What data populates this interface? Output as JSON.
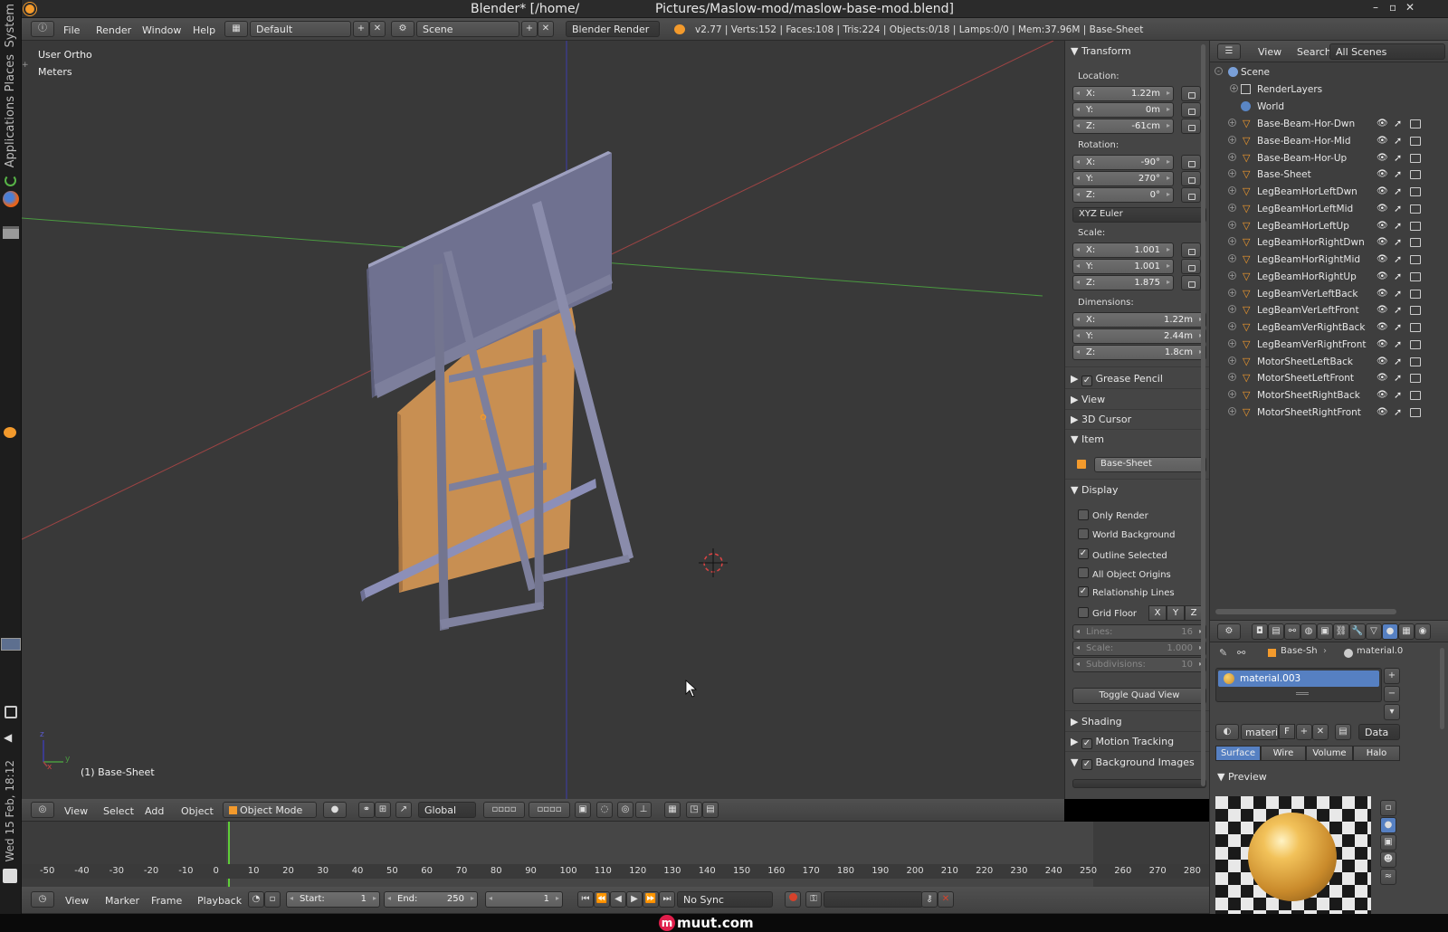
{
  "window": {
    "title_left": "Blender* [/home/",
    "title_right": "Pictures/Maslow-mod/maslow-base-mod.blend]",
    "controls": [
      "–",
      "▫",
      "✕"
    ]
  },
  "os_sidebar": {
    "labels": [
      "System",
      "Places",
      "Applications"
    ],
    "clock": "Wed 15 Feb, 18:12"
  },
  "info_header": {
    "menus": [
      "File",
      "Render",
      "Window",
      "Help"
    ],
    "layout": "Default",
    "scene": "Scene",
    "engine": "Blender Render",
    "stats": "v2.77 | Verts:152 | Faces:108 | Tris:224 | Objects:0/18 | Lamps:0/0 | Mem:37.96M | Base-Sheet"
  },
  "viewport": {
    "view_name": "User Ortho",
    "units": "Meters",
    "object_label": "(1) Base-Sheet",
    "axis_x": "x",
    "axis_y": "y",
    "axis_z": "z"
  },
  "viewport_header": {
    "menus": [
      "View",
      "Select",
      "Add",
      "Object"
    ],
    "mode": "Object Mode",
    "orientation": "Global"
  },
  "n_panel": {
    "transform_title": "Transform",
    "location_label": "Location:",
    "location": [
      {
        "k": "X:",
        "v": "1.22m"
      },
      {
        "k": "Y:",
        "v": "0m"
      },
      {
        "k": "Z:",
        "v": "-61cm"
      }
    ],
    "rotation_label": "Rotation:",
    "rotation": [
      {
        "k": "X:",
        "v": "-90°"
      },
      {
        "k": "Y:",
        "v": "270°"
      },
      {
        "k": "Z:",
        "v": "0°"
      }
    ],
    "rotation_mode": "XYZ Euler",
    "scale_label": "Scale:",
    "scale": [
      {
        "k": "X:",
        "v": "1.001"
      },
      {
        "k": "Y:",
        "v": "1.001"
      },
      {
        "k": "Z:",
        "v": "1.875"
      }
    ],
    "dimensions_label": "Dimensions:",
    "dimensions": [
      {
        "k": "X:",
        "v": "1.22m"
      },
      {
        "k": "Y:",
        "v": "2.44m"
      },
      {
        "k": "Z:",
        "v": "1.8cm"
      }
    ],
    "grease_pencil": "Grease Pencil",
    "view": "View",
    "cursor_3d": "3D Cursor",
    "item": "Item",
    "item_name": "Base-Sheet",
    "display": "Display",
    "display_options": [
      {
        "label": "Only Render",
        "checked": false
      },
      {
        "label": "World Background",
        "checked": false
      },
      {
        "label": "Outline Selected",
        "checked": true
      },
      {
        "label": "All Object Origins",
        "checked": false
      },
      {
        "label": "Relationship Lines",
        "checked": true
      },
      {
        "label": "Grid Floor",
        "checked": false
      }
    ],
    "grid_axes": [
      "X",
      "Y",
      "Z"
    ],
    "lines_label": "Lines:",
    "lines_value": "16",
    "scale_grid_label": "Scale:",
    "scale_grid_value": "1.000",
    "subdivisions_label": "Subdivisions:",
    "subdivisions_value": "10",
    "toggle_quad": "Toggle Quad View",
    "shading": "Shading",
    "motion_tracking": "Motion Tracking",
    "background_images": "Background Images"
  },
  "outliner": {
    "menus": [
      "View",
      "Search"
    ],
    "filter": "All Scenes",
    "scene": "Scene",
    "render_layers": "RenderLayers",
    "world": "World",
    "objects": [
      "Base-Beam-Hor-Dwn",
      "Base-Beam-Hor-Mid",
      "Base-Beam-Hor-Up",
      "Base-Sheet",
      "LegBeamHorLeftDwn",
      "LegBeamHorLeftMid",
      "LegBeamHorLeftUp",
      "LegBeamHorRightDwn",
      "LegBeamHorRightMid",
      "LegBeamHorRightUp",
      "LegBeamVerLeftBack",
      "LegBeamVerLeftFront",
      "LegBeamVerRightBack",
      "LegBeamVerRightFront",
      "MotorSheetLeftBack",
      "MotorSheetLeftFront",
      "MotorSheetRightBack",
      "MotorSheetRightFront"
    ]
  },
  "properties": {
    "breadcrumb_object": "Base-Sh",
    "breadcrumb_material": "material.0",
    "material_slot": "material.003",
    "material_name": "materi",
    "fake_user": "F",
    "data_link": "Data",
    "tabs": [
      "Surface",
      "Wire",
      "Volume",
      "Halo"
    ],
    "preview": "Preview"
  },
  "timeline": {
    "menus": [
      "View",
      "Marker",
      "Frame",
      "Playback"
    ],
    "start_label": "Start:",
    "start": "1",
    "end_label": "End:",
    "end": "250",
    "current": "1",
    "sync": "No Sync",
    "ticks": [
      "-50",
      "-40",
      "-30",
      "-20",
      "-10",
      "0",
      "10",
      "20",
      "30",
      "40",
      "50",
      "60",
      "70",
      "80",
      "90",
      "100",
      "110",
      "120",
      "130",
      "140",
      "150",
      "160",
      "170",
      "180",
      "190",
      "200",
      "210",
      "220",
      "230",
      "240",
      "250",
      "260",
      "270",
      "280"
    ]
  },
  "watermark": "muut.com",
  "colors": {
    "accent": "#5680c2",
    "object_orange": "#f39a2c",
    "board": "#c88f52",
    "beam": "#7d7f9c"
  }
}
